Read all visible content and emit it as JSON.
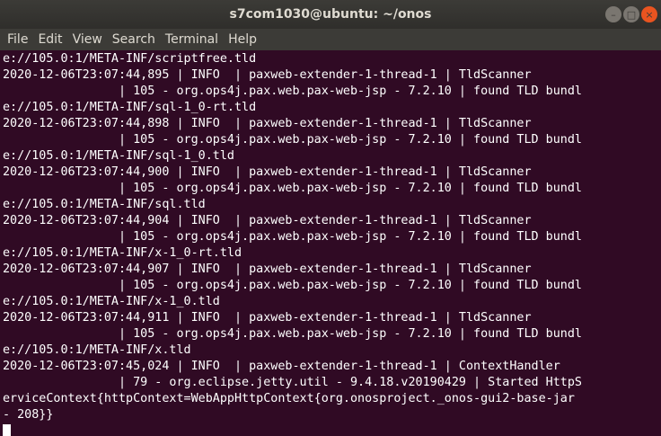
{
  "window": {
    "title": "s7com1030@ubuntu: ~/onos",
    "minimize_glyph": "–",
    "maximize_glyph": "□",
    "close_glyph": "×"
  },
  "menu": [
    "File",
    "Edit",
    "View",
    "Search",
    "Terminal",
    "Help"
  ],
  "terminal": {
    "lines": [
      "e://105.0:1/META-INF/scriptfree.tld",
      "2020-12-06T23:07:44,895 | INFO  | paxweb-extender-1-thread-1 | TldScanner",
      "                | 105 - org.ops4j.pax.web.pax-web-jsp - 7.2.10 | found TLD bundl",
      "e://105.0:1/META-INF/sql-1_0-rt.tld",
      "2020-12-06T23:07:44,898 | INFO  | paxweb-extender-1-thread-1 | TldScanner",
      "                | 105 - org.ops4j.pax.web.pax-web-jsp - 7.2.10 | found TLD bundl",
      "e://105.0:1/META-INF/sql-1_0.tld",
      "2020-12-06T23:07:44,900 | INFO  | paxweb-extender-1-thread-1 | TldScanner",
      "                | 105 - org.ops4j.pax.web.pax-web-jsp - 7.2.10 | found TLD bundl",
      "e://105.0:1/META-INF/sql.tld",
      "2020-12-06T23:07:44,904 | INFO  | paxweb-extender-1-thread-1 | TldScanner",
      "                | 105 - org.ops4j.pax.web.pax-web-jsp - 7.2.10 | found TLD bundl",
      "e://105.0:1/META-INF/x-1_0-rt.tld",
      "2020-12-06T23:07:44,907 | INFO  | paxweb-extender-1-thread-1 | TldScanner",
      "                | 105 - org.ops4j.pax.web.pax-web-jsp - 7.2.10 | found TLD bundl",
      "e://105.0:1/META-INF/x-1_0.tld",
      "2020-12-06T23:07:44,911 | INFO  | paxweb-extender-1-thread-1 | TldScanner",
      "                | 105 - org.ops4j.pax.web.pax-web-jsp - 7.2.10 | found TLD bundl",
      "e://105.0:1/META-INF/x.tld",
      "2020-12-06T23:07:45,024 | INFO  | paxweb-extender-1-thread-1 | ContextHandler",
      "                | 79 - org.eclipse.jetty.util - 9.4.18.v20190429 | Started HttpS",
      "erviceContext{httpContext=WebAppHttpContext{org.onosproject._onos-gui2-base-jar",
      "- 208}}"
    ]
  },
  "colors": {
    "background": "#300a24",
    "titlebar": "#3c3b37",
    "close_button": "#e95420",
    "text": "#ffffff"
  }
}
